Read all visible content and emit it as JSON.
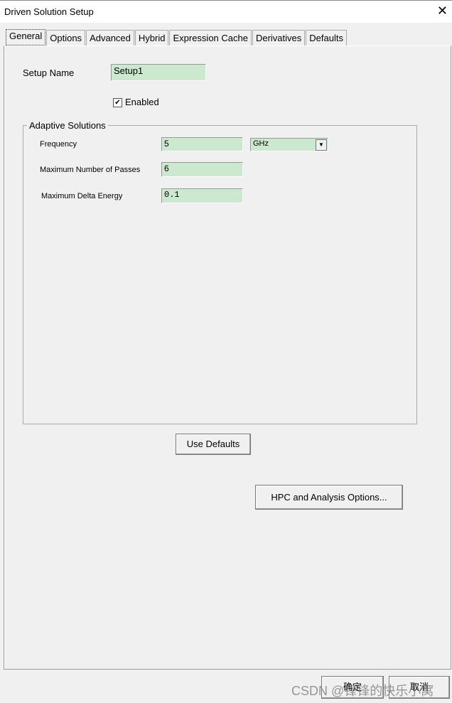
{
  "window": {
    "title": "Driven Solution Setup",
    "close_icon": "close-icon"
  },
  "tabs": [
    {
      "label": "General",
      "active": true
    },
    {
      "label": "Options"
    },
    {
      "label": "Advanced"
    },
    {
      "label": "Hybrid"
    },
    {
      "label": "Expression Cache"
    },
    {
      "label": "Derivatives"
    },
    {
      "label": "Defaults"
    }
  ],
  "general": {
    "setup_name_label": "Setup Name",
    "setup_name_value": "Setup1",
    "enabled_label": "Enabled",
    "enabled_checked": true,
    "adaptive": {
      "title": "Adaptive Solutions",
      "frequency_label": "Frequency",
      "frequency_value": "5",
      "frequency_unit": "GHz",
      "passes_label": "Maximum Number of Passes",
      "passes_value": "6",
      "delta_label": "Maximum Delta Energy",
      "delta_value": "0.1"
    },
    "use_defaults": "Use Defaults",
    "hpc": "HPC and Analysis Options..."
  },
  "footer": {
    "ok": "确定",
    "cancel": "取消"
  },
  "watermark": "CSDN @锋锋的快乐小窝"
}
